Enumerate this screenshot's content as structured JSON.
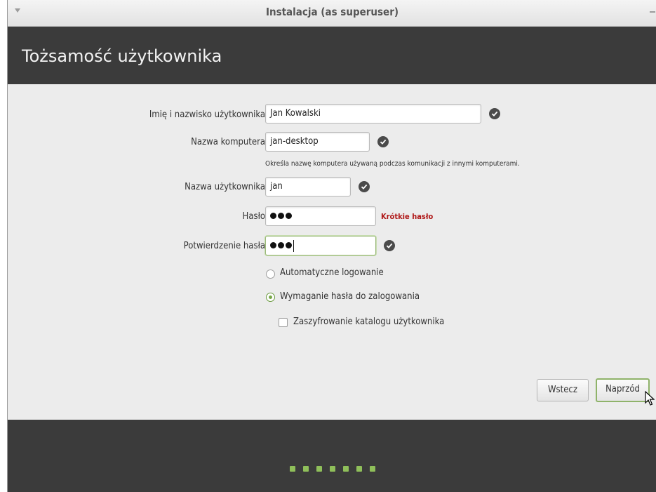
{
  "window": {
    "title": "Instalacja (as superuser)"
  },
  "header": {
    "title": "Tożsamość użytkownika"
  },
  "form": {
    "fullname": {
      "label": "Imię i nazwisko użytkownika:",
      "value": "Jan Kowalski",
      "valid": true
    },
    "computer": {
      "label": "Nazwa komputera:",
      "value": "jan-desktop",
      "valid": true,
      "hint": "Określa nazwę komputera używaną podczas komunikacji z innymi komputerami."
    },
    "username": {
      "label": "Nazwa użytkownika:",
      "value": "jan",
      "valid": true
    },
    "password": {
      "label": "Hasło:",
      "masked_length": 3,
      "strength": "Krótkie hasło"
    },
    "confirm": {
      "label": "Potwierdzenie hasła:",
      "masked_length": 3,
      "valid": true
    }
  },
  "options": {
    "auto_login": {
      "label": "Automatyczne logowanie",
      "selected": false
    },
    "require_password": {
      "label": "Wymaganie hasła do zalogowania",
      "selected": true
    },
    "encrypt_home": {
      "label": "Zaszyfrowanie katalogu użytkownika",
      "checked": false
    }
  },
  "buttons": {
    "back": "Wstecz",
    "forward": "Naprzód"
  },
  "progress": {
    "steps_visible": 7
  },
  "colors": {
    "header_bg": "#3b3b3b",
    "accent_green": "#8fbf5a",
    "warning_red": "#b01a1a"
  }
}
